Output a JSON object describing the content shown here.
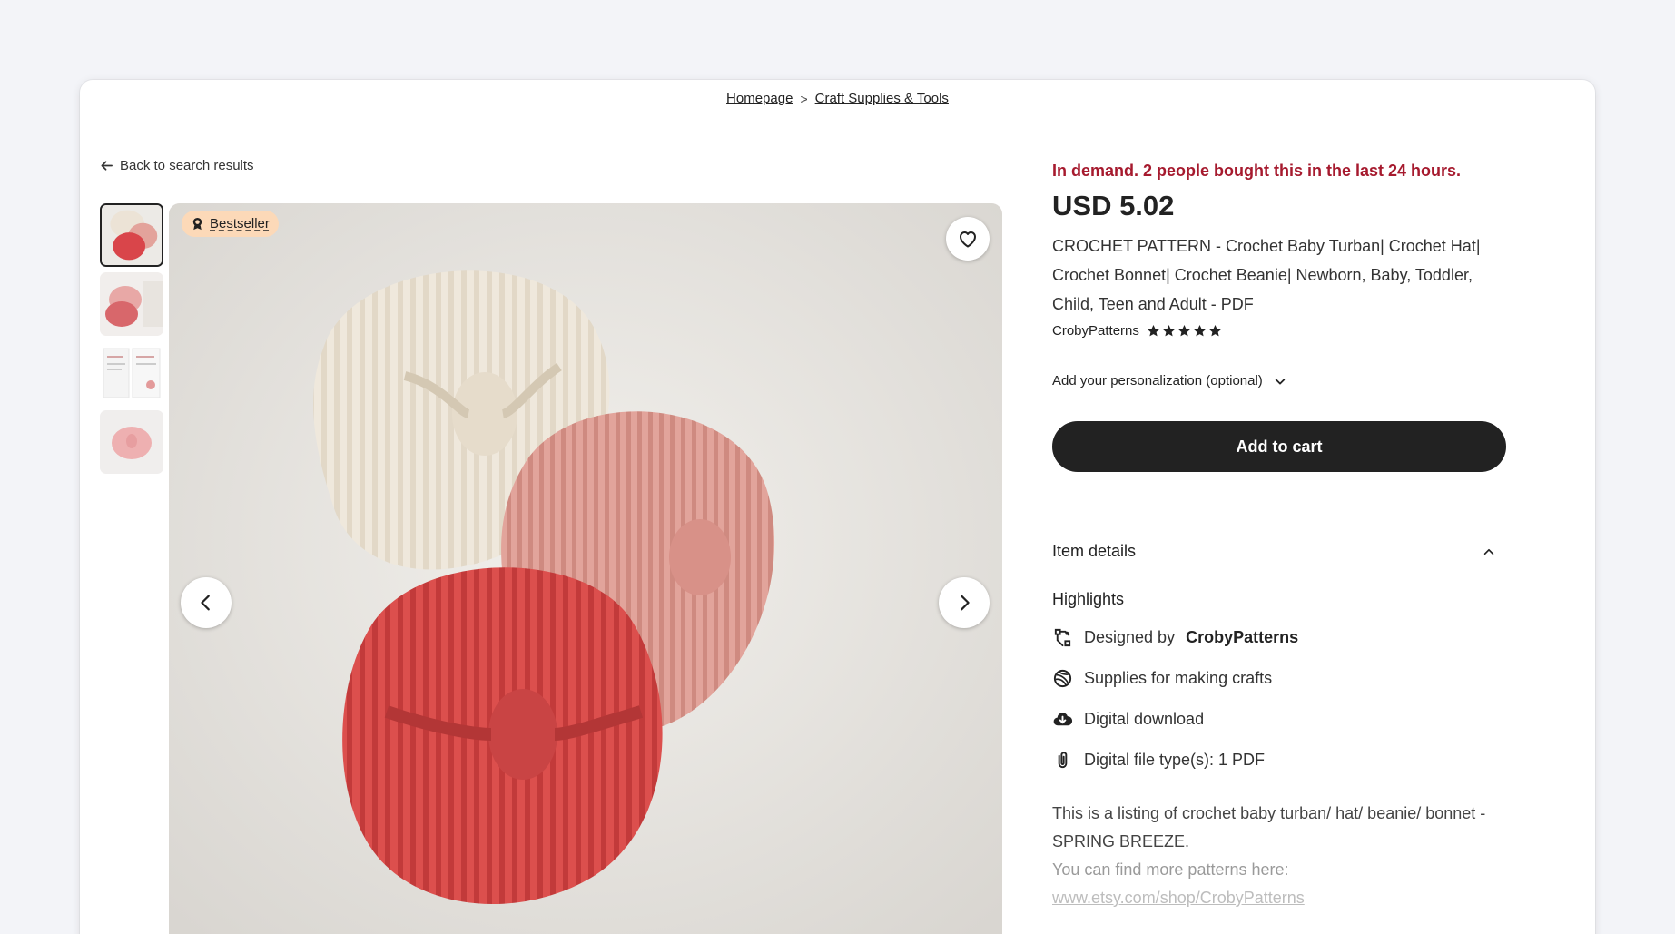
{
  "breadcrumb": {
    "items": [
      "Homepage",
      "Craft Supplies & Tools"
    ],
    "separator": ">"
  },
  "back_link": {
    "label": "Back to search results",
    "icon": "arrow-left-icon"
  },
  "gallery": {
    "badge": {
      "label": "Bestseller",
      "icon": "award-icon"
    },
    "favorite_icon": "heart-icon",
    "prev_icon": "chevron-left-icon",
    "next_icon": "chevron-right-icon",
    "thumbnail_count": 4,
    "active_thumbnail": 1
  },
  "listing": {
    "demand_text": "In demand. 2 people bought this in the last 24 hours.",
    "price": "USD 5.02",
    "title": "CROCHET PATTERN - Crochet Baby Turban| Crochet Hat| Crochet Bonnet| Crochet Beanie| Newborn, Baby, Toddler, Child, Teen and Adult - PDF",
    "shop_name": "CrobyPatterns",
    "rating_stars": 5,
    "personalization_label": "Add your personalization (optional)",
    "add_to_cart_label": "Add to cart"
  },
  "item_details": {
    "heading": "Item details",
    "highlights_title": "Highlights",
    "highlights": {
      "designed_prefix": "Designed by",
      "designed_by": "CrobyPatterns",
      "supplies": "Supplies for making crafts",
      "download": "Digital download",
      "file_type": "Digital file type(s): 1 PDF"
    },
    "description": {
      "line1": "This is a listing of crochet baby turban/ hat/ beanie/ bonnet - SPRING BREEZE.",
      "line2": "You can find more patterns here:",
      "link": "www.etsy.com/shop/CrobyPatterns"
    }
  },
  "colors": {
    "demand": "#a61a2e",
    "button": "#222222",
    "badge": "#fcd9b8",
    "page_bg": "#f3f4f8"
  }
}
